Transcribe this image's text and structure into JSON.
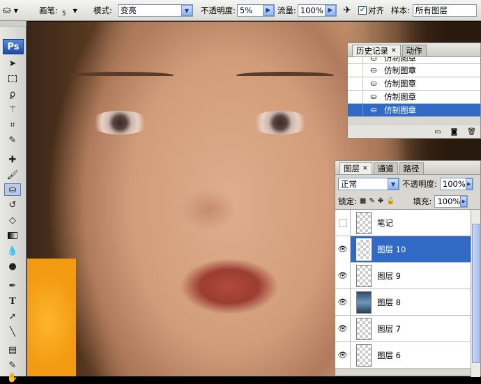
{
  "options_bar": {
    "brush_label": "画笔:",
    "brush_size": "5",
    "mode_label": "模式:",
    "mode_value": "变亮",
    "opacity_label": "不透明度:",
    "opacity_value": "5%",
    "flow_label": "流量:",
    "flow_value": "100%",
    "aligned_label": "对齐",
    "aligned_checked": true,
    "sample_label": "样本:",
    "sample_value": "所有图层"
  },
  "toolbar": {
    "logo": "Ps",
    "tools": [
      "move-icon",
      "marquee-icon",
      "lasso-icon",
      "magic-wand-icon",
      "crop-icon",
      "eyedropper-icon",
      "healing-brush-icon",
      "brush-icon",
      "clone-stamp-icon",
      "history-brush-icon",
      "eraser-icon",
      "gradient-icon",
      "blur-icon",
      "dodge-icon",
      "pen-icon",
      "type-icon",
      "path-selection-icon",
      "line-icon",
      "notes-icon",
      "eyedropper2-icon",
      "hand-icon"
    ],
    "active_tool": "clone-stamp-icon"
  },
  "history_panel": {
    "tabs": [
      "历史记录",
      "动作"
    ],
    "items": [
      {
        "label": "仿制图章",
        "selected": false
      },
      {
        "label": "仿制图章",
        "selected": false
      },
      {
        "label": "仿制图章",
        "selected": false
      },
      {
        "label": "仿制图章",
        "selected": false
      },
      {
        "label": "仿制图章",
        "selected": true
      }
    ]
  },
  "layers_panel": {
    "tabs": [
      "图层",
      "通道",
      "路径"
    ],
    "blend_mode": "正常",
    "opacity_label": "不透明度:",
    "opacity_value": "100%",
    "lock_label": "锁定:",
    "fill_label": "填充:",
    "fill_value": "100%",
    "layers": [
      {
        "name": "笔记",
        "visible": false,
        "selected": false,
        "thumb": "transparent"
      },
      {
        "name": "图层 10",
        "visible": true,
        "selected": true,
        "thumb": "transparent"
      },
      {
        "name": "图层 9",
        "visible": true,
        "selected": false,
        "thumb": "transparent"
      },
      {
        "name": "图层 8",
        "visible": true,
        "selected": false,
        "thumb": "image"
      },
      {
        "name": "图层 7",
        "visible": true,
        "selected": false,
        "thumb": "transparent"
      },
      {
        "name": "图层 6",
        "visible": true,
        "selected": false,
        "thumb": "transparent"
      }
    ]
  }
}
